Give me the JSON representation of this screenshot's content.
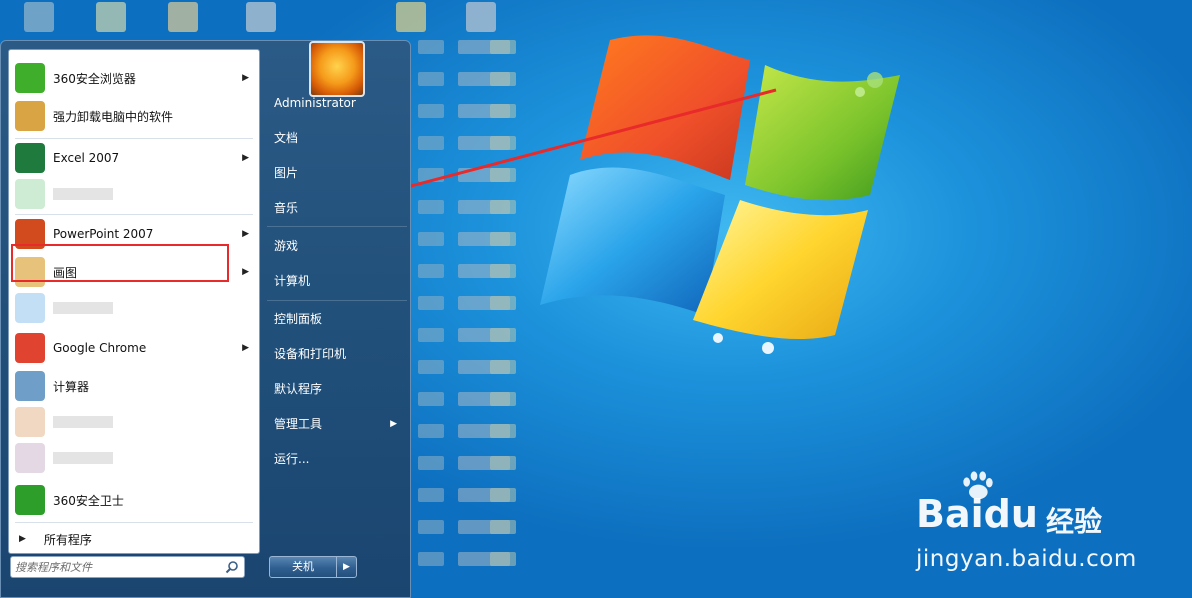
{
  "start_menu": {
    "user_name": "Administrator",
    "programs": [
      {
        "label": "360安全浏览器",
        "icon": "360-browser-icon",
        "has_arrow": true
      },
      {
        "label": "强力卸载电脑中的软件",
        "icon": "uninstall-box-icon",
        "has_arrow": false
      },
      {
        "label": "Excel 2007",
        "icon": "excel-icon",
        "has_arrow": true
      },
      {
        "label": "",
        "icon": "blurred-app-icon",
        "has_arrow": false
      },
      {
        "label": "PowerPoint 2007",
        "icon": "powerpoint-icon",
        "has_arrow": true
      },
      {
        "label": "画图",
        "icon": "paint-palette-icon",
        "has_arrow": true
      },
      {
        "label": "",
        "icon": "blurred-app-icon",
        "has_arrow": false
      },
      {
        "label": "Google Chrome",
        "icon": "chrome-icon",
        "has_arrow": true
      },
      {
        "label": "计算器",
        "icon": "calculator-icon",
        "has_arrow": false
      },
      {
        "label": "",
        "icon": "blurred-app-icon",
        "has_arrow": false
      },
      {
        "label": "",
        "icon": "blurred-app-icon",
        "has_arrow": false
      },
      {
        "label": "360安全卫士",
        "icon": "360-safe-icon",
        "has_arrow": false
      }
    ],
    "all_programs": "所有程序",
    "search_placeholder": "搜索程序和文件",
    "right_items": [
      "文档",
      "图片",
      "音乐",
      "游戏",
      "计算机",
      "控制面板",
      "设备和打印机",
      "默认程序",
      "管理工具",
      "运行..."
    ],
    "shutdown_label": "关机"
  },
  "watermark": {
    "brand": "Baidu",
    "brand_cn": "经验",
    "url": "jingyan.baidu.com"
  },
  "colors": {
    "highlight_border": "#e82a2a",
    "annotation_arrow": "#e82a2a"
  }
}
